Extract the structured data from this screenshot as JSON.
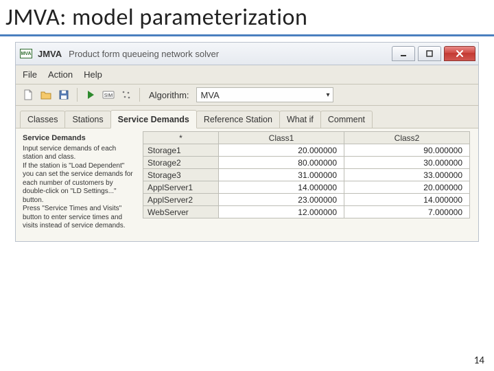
{
  "slide": {
    "title": "JMVA: model parameterization",
    "page_number": "14"
  },
  "window": {
    "app_abbrev": "MVA",
    "title_strong": "JMVA",
    "title_sub": "Product form queueing network solver"
  },
  "menu": {
    "file": "File",
    "action": "Action",
    "help": "Help"
  },
  "toolbar": {
    "algorithm_label": "Algorithm:",
    "algorithm_value": "MVA"
  },
  "tabs": {
    "classes": "Classes",
    "stations": "Stations",
    "service_demands": "Service Demands",
    "reference_station": "Reference Station",
    "what_if": "What if",
    "comment": "Comment"
  },
  "desc": {
    "heading": "Service Demands",
    "p1": "Input service demands of each station and class.",
    "p2": "If the station is \"Load Dependent\" you can set the service demands for each number of customers by double-click on \"LD Settings...\" button.",
    "p3": "Press \"Service Times and Visits\" button to enter service times and visits instead of service demands."
  },
  "grid": {
    "star": "*",
    "col1": "Class1",
    "col2": "Class2",
    "rows": [
      {
        "name": "Storage1",
        "c1": "20.000000",
        "c2": "90.000000"
      },
      {
        "name": "Storage2",
        "c1": "80.000000",
        "c2": "30.000000"
      },
      {
        "name": "Storage3",
        "c1": "31.000000",
        "c2": "33.000000"
      },
      {
        "name": "ApplServer1",
        "c1": "14.000000",
        "c2": "20.000000"
      },
      {
        "name": "ApplServer2",
        "c1": "23.000000",
        "c2": "14.000000"
      },
      {
        "name": "WebServer",
        "c1": "12.000000",
        "c2": "7.000000"
      }
    ]
  }
}
